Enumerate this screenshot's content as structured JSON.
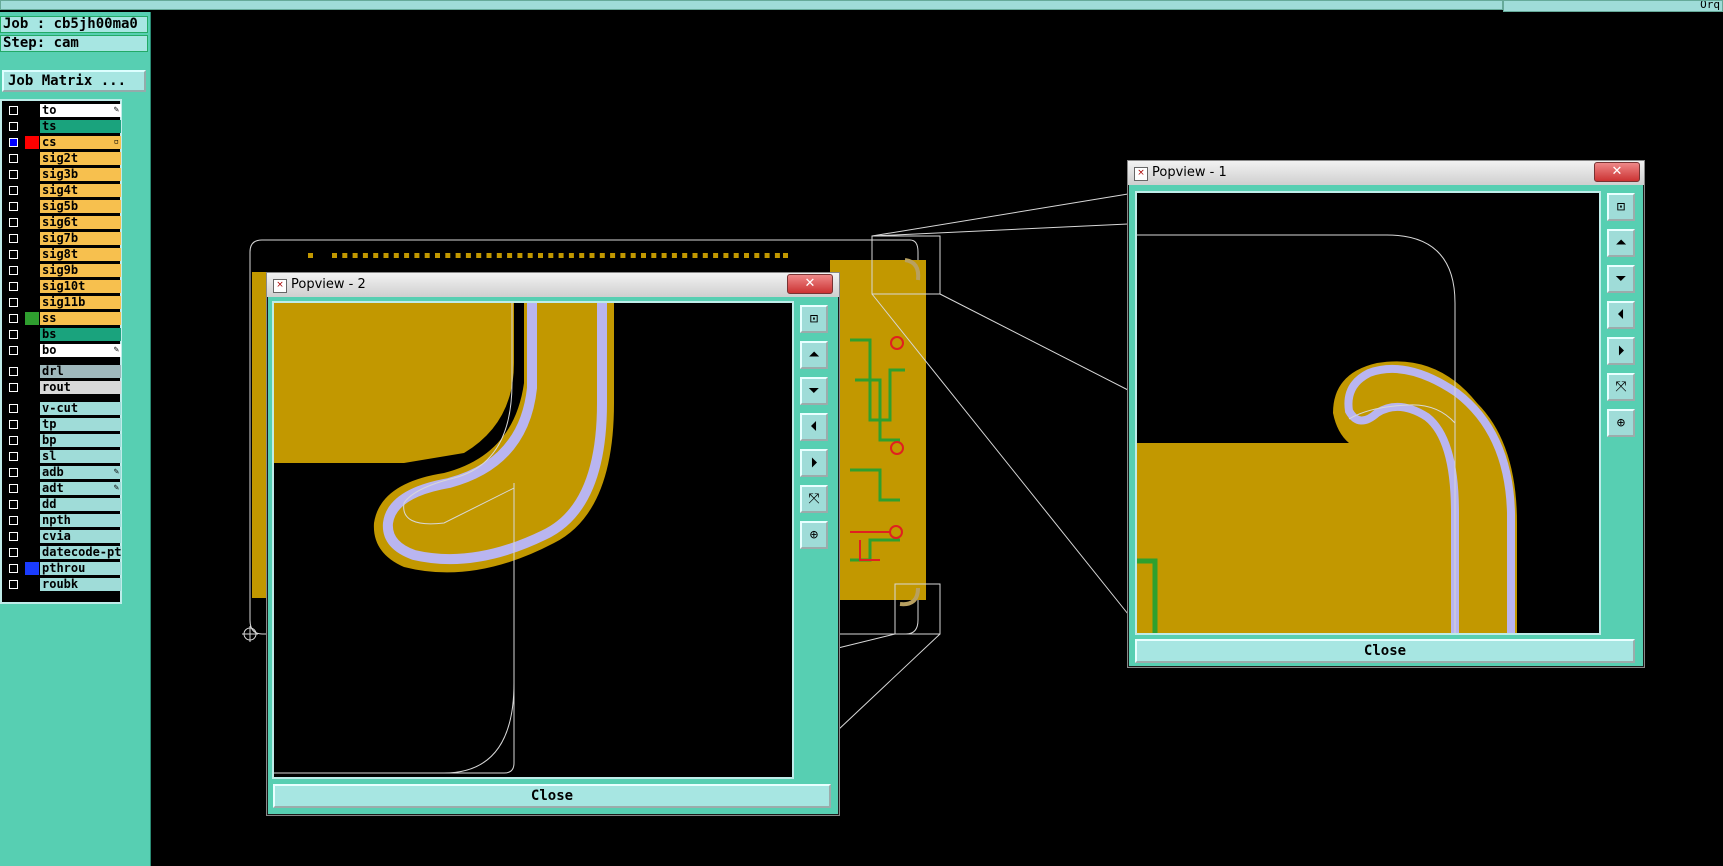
{
  "header": {
    "right_text": "Orq"
  },
  "sidebar": {
    "job_label": "Job : cb5jh00ma0",
    "step_label": "Step: cam",
    "job_matrix_button": "Job Matrix ...",
    "layers": [
      {
        "name": "to",
        "color": "#ffffff",
        "swatch": "#000000",
        "checked": false,
        "mark": "✎"
      },
      {
        "name": "ts",
        "color": "#1aa37d",
        "swatch": "#000000",
        "checked": false,
        "mark": ""
      },
      {
        "name": "cs",
        "color": "#f7c04e",
        "swatch": "#ff0000",
        "checked": true,
        "mark": "▫"
      },
      {
        "name": "sig2t",
        "color": "#f7c04e",
        "swatch": "#000000",
        "checked": false,
        "mark": ""
      },
      {
        "name": "sig3b",
        "color": "#f7c04e",
        "swatch": "#000000",
        "checked": false,
        "mark": ""
      },
      {
        "name": "sig4t",
        "color": "#f7c04e",
        "swatch": "#000000",
        "checked": false,
        "mark": ""
      },
      {
        "name": "sig5b",
        "color": "#f7c04e",
        "swatch": "#000000",
        "checked": false,
        "mark": ""
      },
      {
        "name": "sig6t",
        "color": "#f7c04e",
        "swatch": "#000000",
        "checked": false,
        "mark": ""
      },
      {
        "name": "sig7b",
        "color": "#f7c04e",
        "swatch": "#000000",
        "checked": false,
        "mark": ""
      },
      {
        "name": "sig8t",
        "color": "#f7c04e",
        "swatch": "#000000",
        "checked": false,
        "mark": ""
      },
      {
        "name": "sig9b",
        "color": "#f7c04e",
        "swatch": "#000000",
        "checked": false,
        "mark": ""
      },
      {
        "name": "sig10t",
        "color": "#f7c04e",
        "swatch": "#000000",
        "checked": false,
        "mark": ""
      },
      {
        "name": "sig11b",
        "color": "#f7c04e",
        "swatch": "#000000",
        "checked": false,
        "mark": ""
      },
      {
        "name": "ss",
        "color": "#f7c04e",
        "swatch": "#2f9e2f",
        "checked": false,
        "mark": ""
      },
      {
        "name": "bs",
        "color": "#1aa37d",
        "swatch": "#000000",
        "checked": false,
        "mark": ""
      },
      {
        "name": "bo",
        "color": "#ffffff",
        "swatch": "#000000",
        "checked": false,
        "mark": "✎"
      },
      {
        "name": "drl",
        "color": "#9fb8bc",
        "swatch": "#000000",
        "checked": false,
        "mark": ""
      },
      {
        "name": "rout",
        "color": "#d8d8d8",
        "swatch": "#000000",
        "checked": false,
        "mark": ""
      },
      {
        "name": "v-cut",
        "color": "#9fdcd8",
        "swatch": "#000000",
        "checked": false,
        "mark": ""
      },
      {
        "name": "tp",
        "color": "#9fdcd8",
        "swatch": "#000000",
        "checked": false,
        "mark": ""
      },
      {
        "name": "bp",
        "color": "#9fdcd8",
        "swatch": "#000000",
        "checked": false,
        "mark": ""
      },
      {
        "name": "sl",
        "color": "#9fdcd8",
        "swatch": "#000000",
        "checked": false,
        "mark": ""
      },
      {
        "name": "adb",
        "color": "#9fdcd8",
        "swatch": "#000000",
        "checked": false,
        "mark": "✎"
      },
      {
        "name": "adt",
        "color": "#9fdcd8",
        "swatch": "#000000",
        "checked": false,
        "mark": "✎"
      },
      {
        "name": "dd",
        "color": "#9fdcd8",
        "swatch": "#000000",
        "checked": false,
        "mark": ""
      },
      {
        "name": "npth",
        "color": "#9fdcd8",
        "swatch": "#000000",
        "checked": false,
        "mark": ""
      },
      {
        "name": "cvia",
        "color": "#9fdcd8",
        "swatch": "#000000",
        "checked": false,
        "mark": ""
      },
      {
        "name": "datecode-pte",
        "color": "#9fdcd8",
        "swatch": "#000000",
        "checked": false,
        "mark": ""
      },
      {
        "name": "pthrou",
        "color": "#9fdcd8",
        "swatch": "#1a3cff",
        "checked": false,
        "mark": ""
      },
      {
        "name": "roubk",
        "color": "#9fdcd8",
        "swatch": "#000000",
        "checked": false,
        "mark": ""
      }
    ]
  },
  "popview1": {
    "title": "Popview - 1",
    "close_label": "Close",
    "close_x": "✕"
  },
  "popview2": {
    "title": "Popview - 2",
    "close_label": "Close",
    "close_x": "✕"
  },
  "tool_icons": [
    "zoom-home-icon",
    "pan-up-icon",
    "pan-down-icon",
    "pan-left-icon",
    "pan-right-icon",
    "zoom-fit-icon",
    "zoom-reset-icon"
  ],
  "colors": {
    "copper": "#c29800",
    "clearance": "#b9b5f0",
    "trace": "#2ea02e",
    "drill": "#e02020",
    "outline": "#d8d8d8"
  }
}
